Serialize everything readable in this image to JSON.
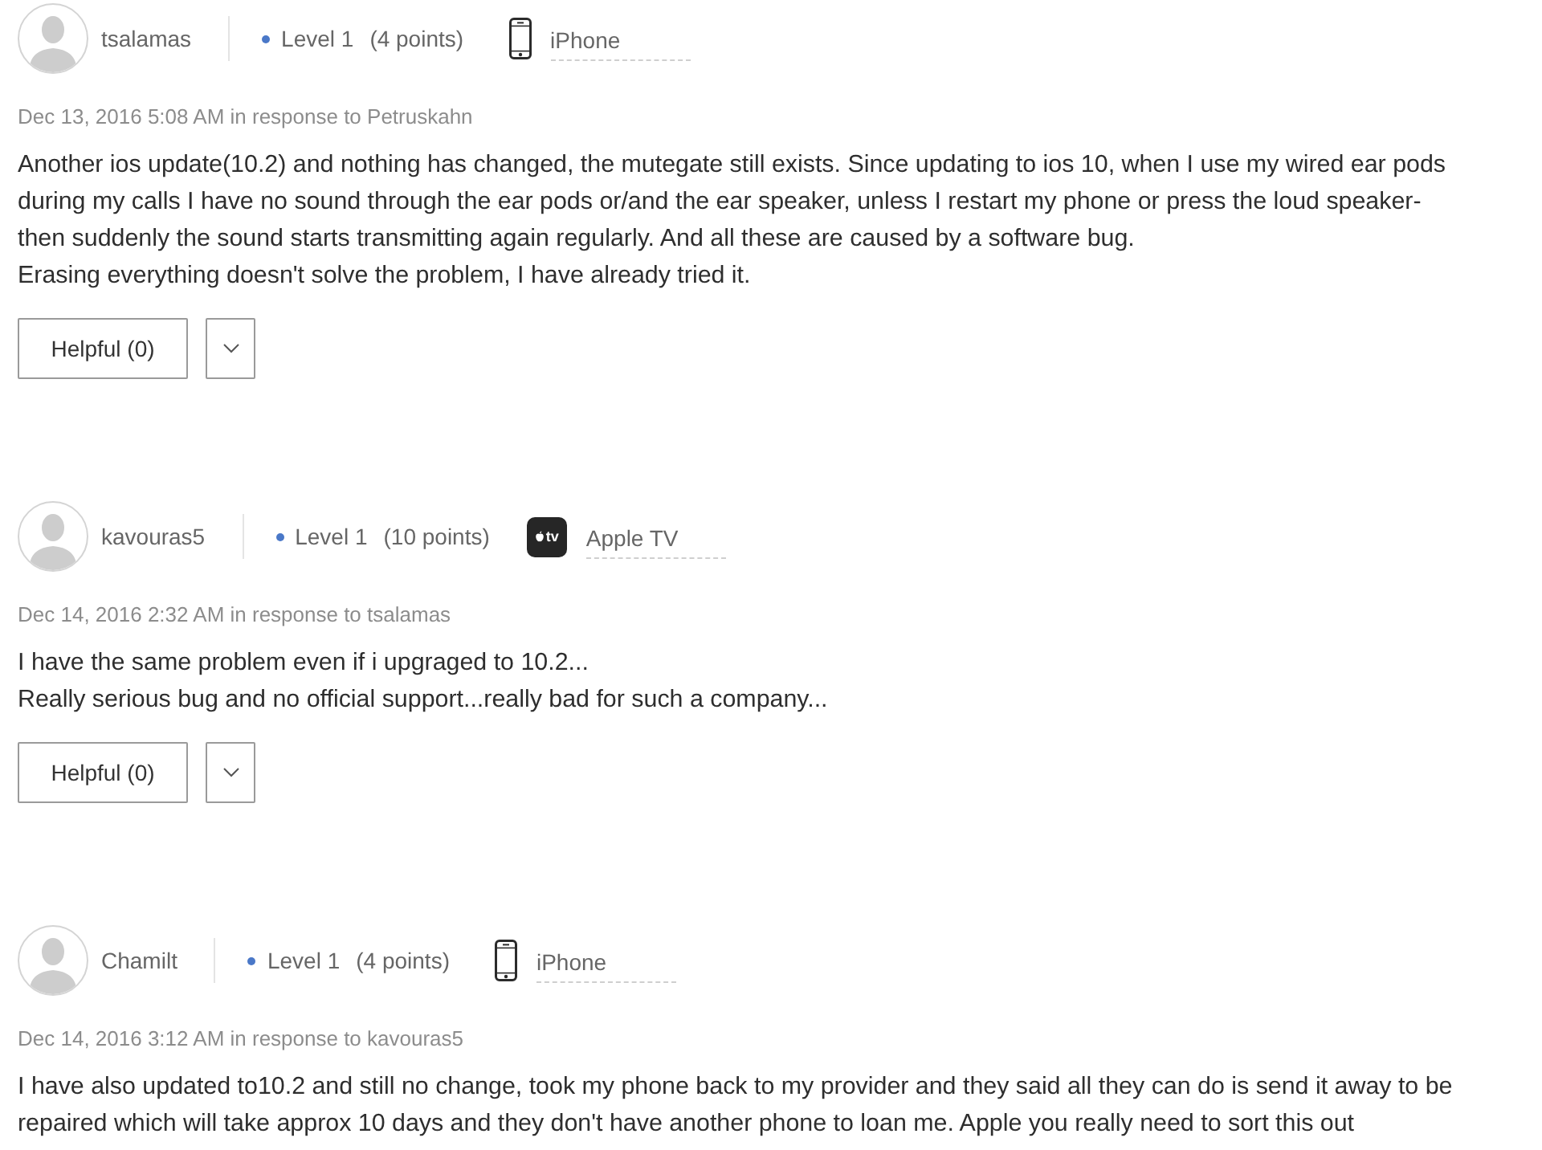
{
  "posts": [
    {
      "author": "tsalamas",
      "level": "Level 1",
      "points": "(4 points)",
      "device": {
        "kind": "phone",
        "name": "iPhone"
      },
      "meta": "Dec 13, 2016 5:08 AM in response to Petruskahn",
      "body": [
        "Another ios update(10.2) and nothing has changed, the mutegate still exists. Since updating to ios 10, when I use my wired ear pods",
        "during my calls I have no sound through the ear pods or/and the ear speaker, unless I restart my phone or press the loud speaker-",
        "then suddenly the sound starts transmitting again regularly. And all these are caused by a software bug.",
        "Erasing everything doesn't solve the problem, I have already tried it."
      ],
      "helpful": "Helpful (0)"
    },
    {
      "author": "kavouras5",
      "level": "Level 1",
      "points": "(10 points)",
      "device": {
        "kind": "tv",
        "logo_text": "tv",
        "name": "Apple TV"
      },
      "meta": "Dec 14, 2016 2:32 AM in response to tsalamas",
      "body": [
        "I have the same problem even if i upgraged to 10.2...",
        "Really serious bug and no official support...really bad for such a company..."
      ],
      "helpful": "Helpful (0)"
    },
    {
      "author": "Chamilt",
      "level": "Level 1",
      "points": "(4 points)",
      "device": {
        "kind": "phone",
        "name": "iPhone"
      },
      "meta": "Dec 14, 2016 3:12 AM in response to kavouras5",
      "body": [
        "I have also updated to10.2 and still no change, took my phone back to my provider and they said all they can do is send it away to be",
        "repaired which will take approx 10 days and they don't have another phone to loan me.  Apple you really need to sort this out"
      ]
    }
  ]
}
